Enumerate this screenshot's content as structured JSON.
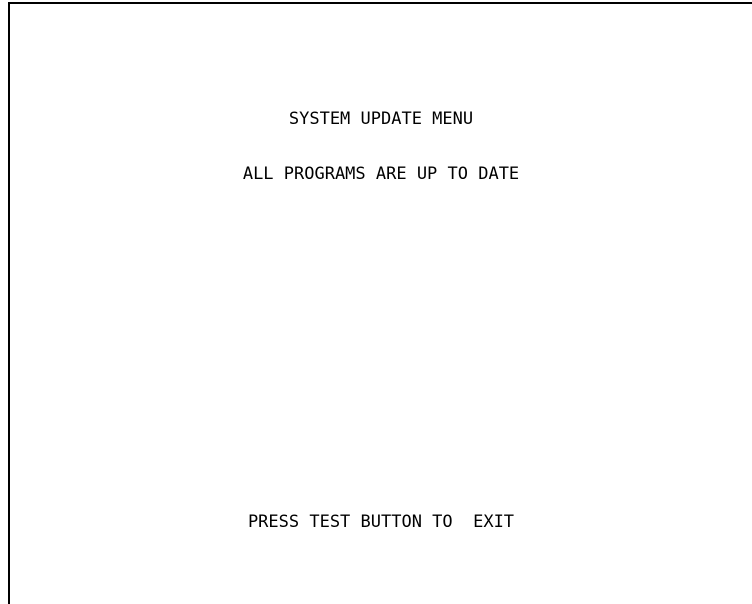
{
  "menu": {
    "title": "SYSTEM UPDATE MENU",
    "status": "ALL PROGRAMS ARE UP TO DATE",
    "footer": "PRESS TEST BUTTON TO  EXIT"
  },
  "colors": {
    "background": "#ffffff",
    "text": "#000000",
    "border": "#000000"
  }
}
